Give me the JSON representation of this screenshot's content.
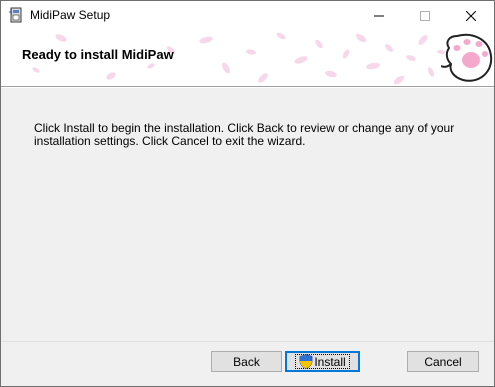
{
  "window": {
    "title": "MidiPaw Setup",
    "icons": {
      "app": "installer-package-icon",
      "minimize": "minimize-icon",
      "maximize": "maximize-icon",
      "close": "close-icon"
    }
  },
  "banner": {
    "title": "Ready to install MidiPaw",
    "art": "cherry-blossom-petals",
    "logo": "cat-paw-icon"
  },
  "body": {
    "message": "Click Install to begin the installation. Click Back to review or change any of your installation settings. Click Cancel to exit the wizard."
  },
  "buttons": {
    "back": "Back",
    "install": "Install",
    "cancel": "Cancel",
    "install_icon": "uac-shield-icon"
  },
  "colors": {
    "focus_border": "#0078d7",
    "petal_pink": "#f2b8d9",
    "paw_pink": "#f4a9cc"
  }
}
